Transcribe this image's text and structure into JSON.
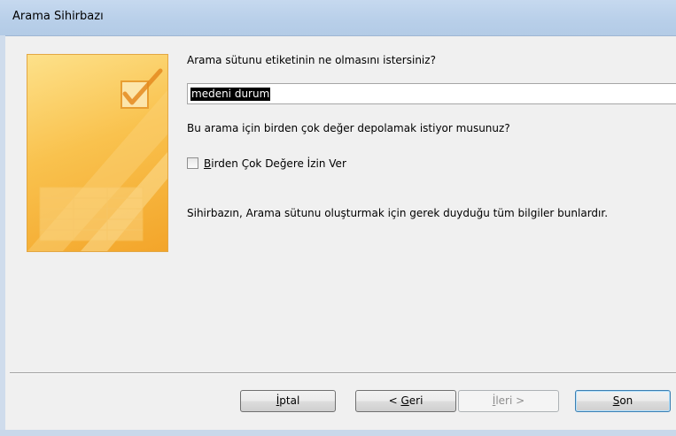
{
  "window": {
    "title": "Arama Sihirbazı"
  },
  "main": {
    "label_question": "Arama sütunu etiketinin ne olmasını istersiniz?",
    "label_value": "medeni durum",
    "multi_question": "Bu arama için birden çok değer depolamak istiyor musunuz?",
    "checkbox": {
      "mnemonic": "B",
      "label_rest": "irden Çok Değere İzin Ver",
      "checked": false
    },
    "info_text": "Sihirbazın, Arama sütunu oluşturmak için gerek duyduğu tüm bilgiler bunlardır."
  },
  "buttons": {
    "cancel": {
      "mnemonic": "İ",
      "rest": "ptal"
    },
    "back": {
      "prefix": "< ",
      "mnemonic": "G",
      "rest": "eri"
    },
    "next": {
      "mnemonic": "İ",
      "rest": "leri >",
      "enabled": false
    },
    "finish": {
      "mnemonic": "S",
      "rest": "on"
    }
  },
  "colors": {
    "graphic_accent": "#f3a52a",
    "default_button_border": "#3c7fb1"
  },
  "icons": {
    "wizard_graphic": "table-checkmark-icon"
  }
}
